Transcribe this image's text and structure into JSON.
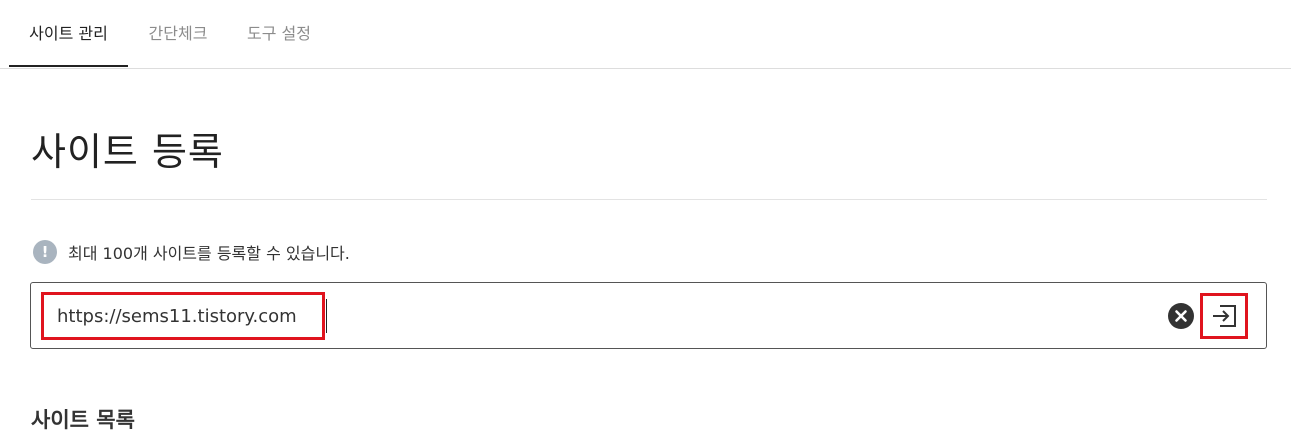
{
  "tabs": [
    {
      "label": "사이트 관리",
      "active": true
    },
    {
      "label": "간단체크",
      "active": false
    },
    {
      "label": "도구 설정",
      "active": false
    }
  ],
  "page": {
    "title": "사이트 등록",
    "notice_icon": "exclamation-icon",
    "notice": "최대 100개 사이트를 등록할 수 있습니다.",
    "list_title": "사이트 목록"
  },
  "url_field": {
    "value": "https://sems11.tistory.com",
    "clear_icon": "close-circle-icon",
    "submit_icon": "login-arrow-icon"
  },
  "colors": {
    "highlight": "#e0141e",
    "notice_icon_bg": "#a9b4bf",
    "active_tab": "#222222",
    "inactive_tab": "#8c8c8c"
  }
}
